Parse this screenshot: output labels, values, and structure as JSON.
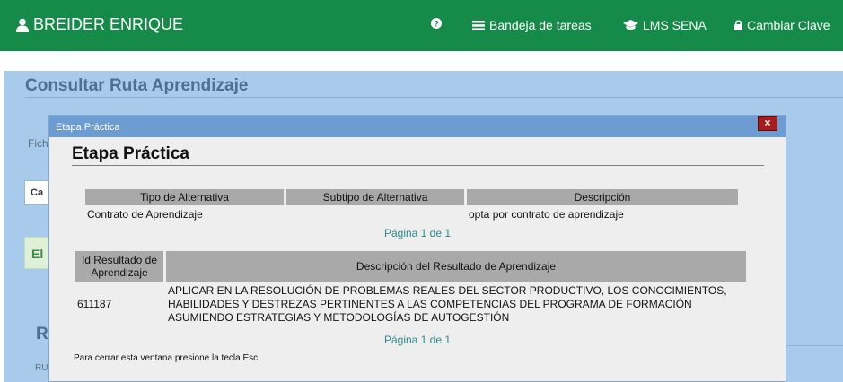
{
  "navbar": {
    "user_name": "BREIDER ENRIQUE",
    "links": [
      {
        "label": "Bandeja de tareas",
        "icon": "tray-list-icon"
      },
      {
        "label": "LMS SENA",
        "icon": "graduation-cap-icon"
      },
      {
        "label": "Cambiar Clave",
        "icon": "lock-icon"
      }
    ],
    "help_icon": "question-circle-icon",
    "color": "#168a49"
  },
  "background_page": {
    "title": "Consultar Ruta Aprendizaje",
    "partial_label_1": "Fich",
    "partial_button": "Ca",
    "partial_alert": "El",
    "partial_heading": "R",
    "partial_label_2": "RU"
  },
  "dialog": {
    "bar_title": "Etapa Práctica",
    "close_label": "×",
    "title": "Etapa Práctica",
    "alternatives_table": {
      "headers": [
        "Tipo de Alternativa",
        "Subtipo de Alternativa",
        "Descripción"
      ],
      "rows": [
        [
          "Contrato de Aprendizaje",
          "",
          "opta por contrato de aprendizaje"
        ]
      ],
      "pager": "Página 1 de 1"
    },
    "results_table": {
      "headers": [
        "Id Resultado de Aprendizaje",
        "Descripción del Resultado de Aprendizaje"
      ],
      "rows": [
        [
          "611187",
          "APLICAR EN LA RESOLUCIÓN DE PROBLEMAS REALES DEL SECTOR PRODUCTIVO, LOS CONOCIMIENTOS, HABILIDADES Y DESTREZAS PERTINENTES A LAS COMPETENCIAS DEL PROGRAMA DE FORMACIÓN ASUMIENDO ESTRATEGIAS Y METODOLOGÍAS DE AUTOGESTIÓN"
        ]
      ],
      "pager": "Página 1 de 1"
    },
    "esc_note": "Para cerrar esta ventana presione la tecla Esc."
  }
}
